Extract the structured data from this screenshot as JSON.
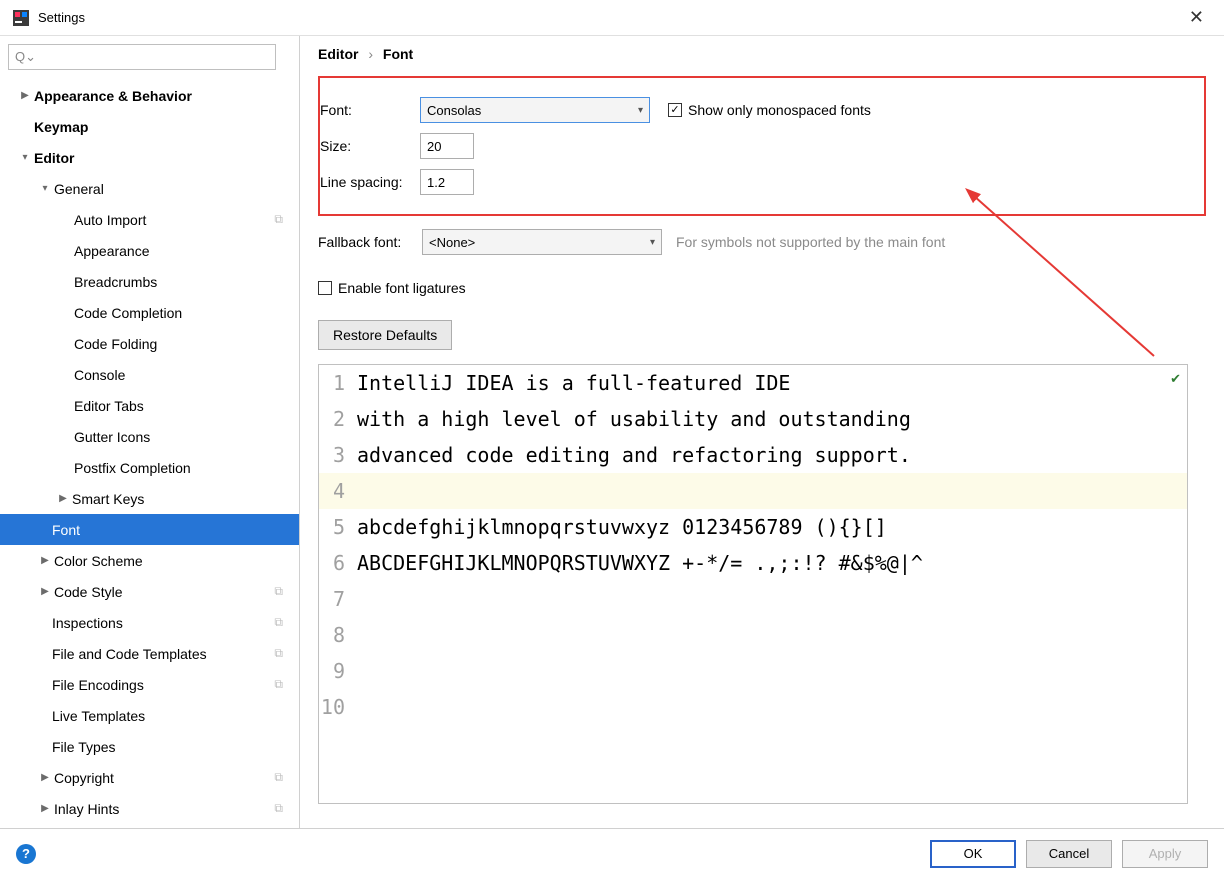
{
  "window": {
    "title": "Settings"
  },
  "search": {
    "placeholder": ""
  },
  "tree": {
    "appearance": "Appearance & Behavior",
    "keymap": "Keymap",
    "editor": "Editor",
    "general": "General",
    "auto_import": "Auto Import",
    "appearance2": "Appearance",
    "breadcrumbs": "Breadcrumbs",
    "code_completion": "Code Completion",
    "code_folding": "Code Folding",
    "console": "Console",
    "editor_tabs": "Editor Tabs",
    "gutter_icons": "Gutter Icons",
    "postfix": "Postfix Completion",
    "smart_keys": "Smart Keys",
    "font": "Font",
    "color_scheme": "Color Scheme",
    "code_style": "Code Style",
    "inspections": "Inspections",
    "file_templates": "File and Code Templates",
    "file_encodings": "File Encodings",
    "live_templates": "Live Templates",
    "file_types": "File Types",
    "copyright": "Copyright",
    "inlay_hints": "Inlay Hints"
  },
  "breadcrumb": {
    "root": "Editor",
    "leaf": "Font"
  },
  "form": {
    "font_label": "Font:",
    "font_value": "Consolas",
    "show_mono": "Show only monospaced fonts",
    "size_label": "Size:",
    "size_value": "20",
    "spacing_label": "Line spacing:",
    "spacing_value": "1.2",
    "fallback_label": "Fallback font:",
    "fallback_value": "<None>",
    "fallback_hint": "For symbols not supported by the main font",
    "ligatures": "Enable font ligatures",
    "restore": "Restore Defaults"
  },
  "preview": {
    "l1": "IntelliJ IDEA is a full-featured IDE",
    "l2": "with a high level of usability and outstanding",
    "l3": "advanced code editing and refactoring support.",
    "l4": "",
    "l5": "abcdefghijklmnopqrstuvwxyz 0123456789 (){}[]",
    "l6": "ABCDEFGHIJKLMNOPQRSTUVWXYZ +-*/= .,;:!? #&$%@|^",
    "l7": "",
    "l8": "",
    "l9": "",
    "l10": ""
  },
  "buttons": {
    "ok": "OK",
    "cancel": "Cancel",
    "apply": "Apply"
  }
}
